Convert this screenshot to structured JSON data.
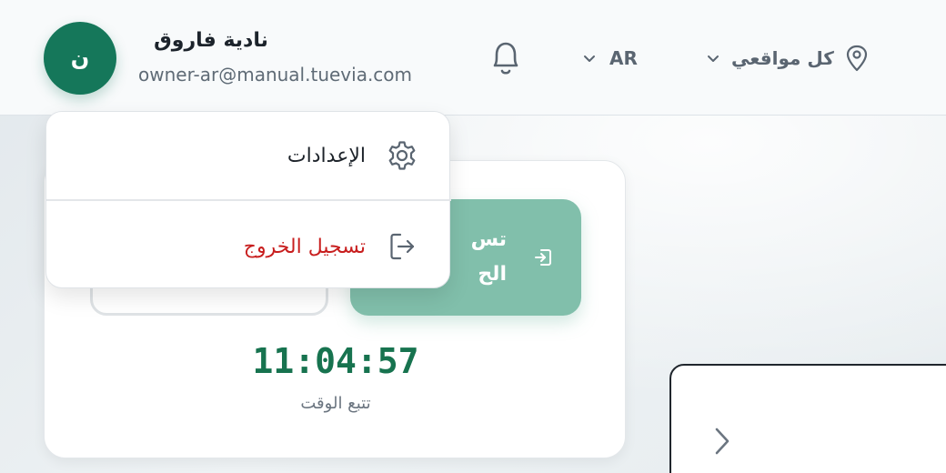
{
  "header": {
    "avatar_initial": "ن",
    "user_name": "نادية فاروق",
    "user_email": "owner-ar@manual.tuevia.com",
    "language": "AR",
    "location": "كل مواقعي"
  },
  "user_menu": {
    "settings_label": "الإعدادات",
    "logout_label": "تسجيل الخروج"
  },
  "attendance_card": {
    "check_in_label_line1": "تس",
    "check_in_label_line2": "الح",
    "clock_time": "11:04:57",
    "clock_label": "تتبع الوقت"
  },
  "colors": {
    "brand": "#15775a",
    "check_in": "#81bfab",
    "logout": "#c81e1e"
  }
}
